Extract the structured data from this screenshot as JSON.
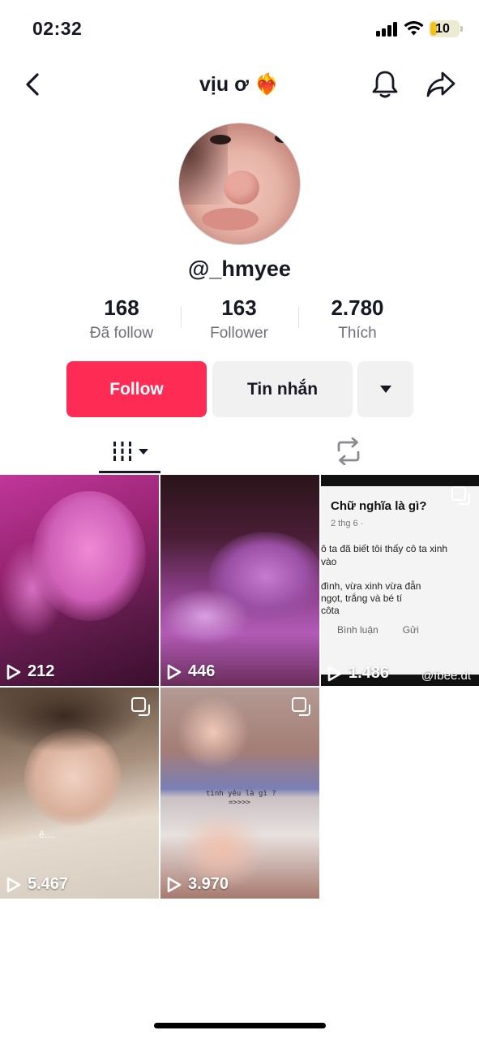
{
  "status_bar": {
    "time": "02:32",
    "battery": "10"
  },
  "header": {
    "title": "vịu ơ ❤️‍🔥",
    "back_icon": "chevron-left-icon",
    "bell_icon": "bell-icon",
    "share_icon": "share-arrow-icon"
  },
  "profile": {
    "username": "@_hmyee",
    "stats": [
      {
        "value": "168",
        "label": "Đã follow"
      },
      {
        "value": "163",
        "label": "Follower"
      },
      {
        "value": "2.780",
        "label": "Thích"
      }
    ]
  },
  "actions": {
    "follow_label": "Follow",
    "message_label": "Tin nhắn"
  },
  "tabs": {
    "videos_icon": "grid-bars-icon",
    "repost_icon": "repost-icon"
  },
  "videos": [
    {
      "views": "212"
    },
    {
      "views": "446"
    },
    {
      "views": "1.486",
      "title": "Chữ nghĩa là gì?",
      "meta": "2 thg 6 ·",
      "lines": [
        "ô ta đã biết tôi thấy cô ta xinh",
        "vào",
        "đình, vừa xinh vừa đẫn",
        " ngọt, trắng và bé tí",
        "côta"
      ],
      "action1": "Bình luận",
      "action2": "Gửi",
      "watermark": "@fbee.dt"
    },
    {
      "views": "5.467",
      "caption": "ê...."
    },
    {
      "views": "3.970",
      "overlay": "tình yêu là gì ?",
      "overlay2": "=>>>>"
    }
  ],
  "colors": {
    "accent": "#fe2c55",
    "secondary_button": "#f1f1f2",
    "text": "#161823"
  }
}
